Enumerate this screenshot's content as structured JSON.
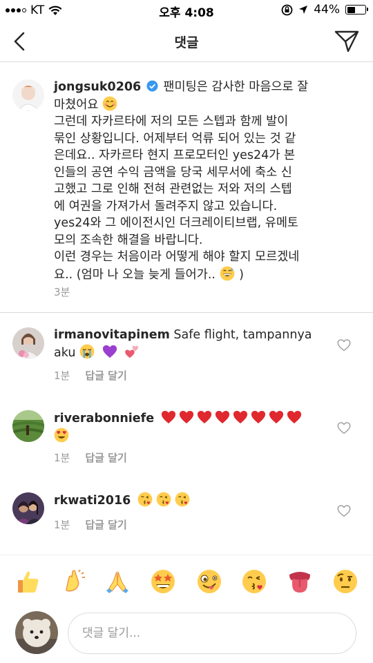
{
  "status_bar": {
    "carrier": "KT",
    "time": "오후 4:08",
    "battery": "44%"
  },
  "header": {
    "title": "댓글"
  },
  "caption": {
    "username": "jongsuk0206",
    "line1_text": "팬미팅은 감사한 마음으로 잘",
    "line2_text": "마쳤어요",
    "body_lines": [
      "그런데 자카르타에 저의 모든 스텝과 함께 발이",
      "묶인 상황입니다. 어제부터 억류 되어 있는 것 같",
      "은데요.. 자카르타 현지 프로모터인 yes24가 본",
      "인들의 공연 수익 금액을 당국 세무서에 축소 신",
      "고했고 그로 인해 전혀 관련없는 저와 저의 스텝",
      "에 여권을 가져가서 돌려주지 않고 있습니다.",
      "yes24와 그 에이전시인 더크레이티브랩, 유메토",
      "모의 조속한 해결을 바랍니다.",
      "이런 경우는 처음이라 어떻게 해야 할지 모르겠네"
    ],
    "last_line": "요.. (엄마 나 오늘 늦게 들어가..",
    "last_close": ")",
    "time_ago": "3분"
  },
  "comments": [
    {
      "username": "irmanovitapinem",
      "text1": "Safe flight, tampannya",
      "text2": "aku",
      "time_ago": "1분",
      "reply_label": "답글 달기"
    },
    {
      "username": "riverabonniefe",
      "time_ago": "1분",
      "reply_label": "답글 달기"
    },
    {
      "username": "rkwati2016",
      "time_ago": "1분",
      "reply_label": "답글 달기"
    }
  ],
  "emoji_bar": [
    "thumbs-up",
    "clapping-hands",
    "folded-hands",
    "star-struck",
    "zany-face",
    "face-blowing-kiss",
    "tongue",
    "face-with-raised-eyebrow"
  ],
  "comment_input": {
    "placeholder": "댓글 달기..."
  },
  "colors": {
    "text": "#262626",
    "secondary": "#999999",
    "verified": "#3897f0",
    "heart_red": "#e0282f",
    "border": "#dbdbdb"
  }
}
